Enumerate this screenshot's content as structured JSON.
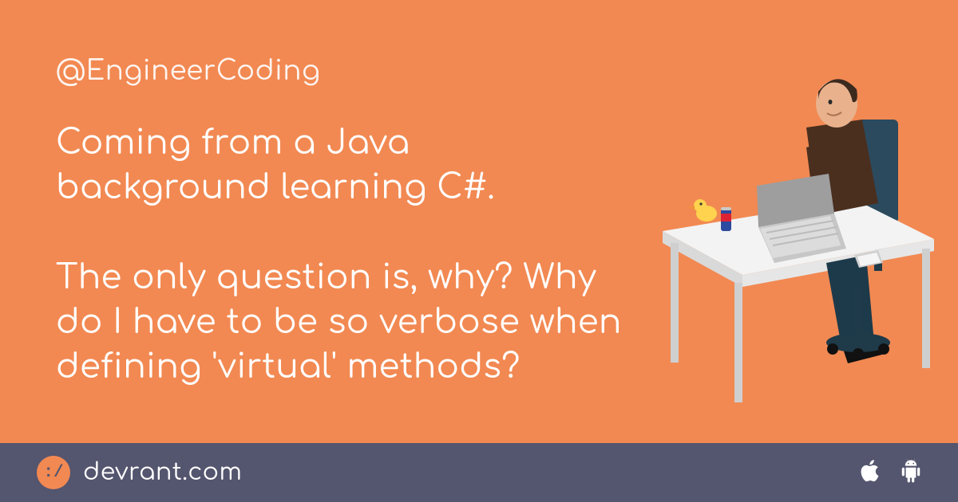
{
  "username": "@EngineerCoding",
  "rant": "Coming from a Java background learning C#.\n\nThe only question is, why? Why do I have to be so verbose when defining 'virtual' methods?",
  "footer": {
    "logo_glyph": ":/",
    "brand": "devrant.com"
  },
  "colors": {
    "bg": "#f28952",
    "footer": "#54556e",
    "text": "#ffffff"
  }
}
